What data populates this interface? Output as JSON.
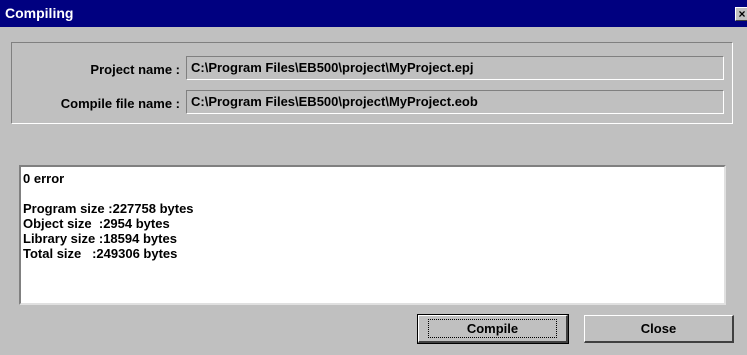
{
  "window": {
    "title": "Compiling",
    "close_glyph": "×"
  },
  "project": {
    "name_label": "Project name :",
    "name_value": "C:\\Program Files\\EB500\\project\\MyProject.epj",
    "compile_label": "Compile file name :",
    "compile_value": "C:\\Program Files\\EB500\\project\\MyProject.eob"
  },
  "output": {
    "lines": [
      "0 error",
      "",
      "Program size :227758 bytes",
      "Object size  :2954 bytes",
      "Library size :18594 bytes",
      "Total size   :249306 bytes"
    ]
  },
  "buttons": {
    "compile": "Compile",
    "close": "Close"
  }
}
